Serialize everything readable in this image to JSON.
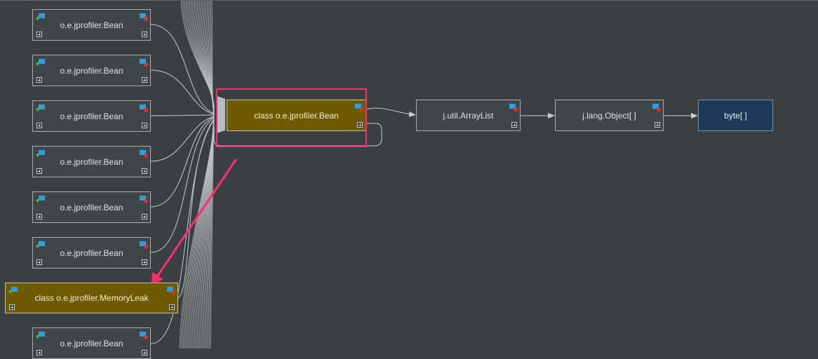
{
  "colors": {
    "background": "#3a3f41",
    "node": "#3f4548",
    "highlight_node": "#6e5a00",
    "array_node": "#1e3a58",
    "annotation": "#ff2d6e",
    "edge": "#c8cccf"
  },
  "icons": {
    "incoming": "incoming-references-icon",
    "outgoing": "outgoing-references-icon",
    "expand": "expand-plus-icon"
  },
  "left_nodes": [
    {
      "label": "o.e.jprofiler.Bean"
    },
    {
      "label": "o.e.jprofiler.Bean"
    },
    {
      "label": "o.e.jprofiler.Bean"
    },
    {
      "label": "o.e.jprofiler.Bean"
    },
    {
      "label": "o.e.jprofiler.Bean"
    },
    {
      "label": "o.e.jprofiler.Bean"
    },
    {
      "label": "class o.e.jprofiler.MemoryLeak"
    },
    {
      "label": "o.e.jprofiler.Bean"
    }
  ],
  "center_node": {
    "label": "class o.e.jprofiler.Bean"
  },
  "chain": [
    {
      "label": "j.util.ArrayList"
    },
    {
      "label": "j.lang.Object[ ]"
    },
    {
      "label": "byte[ ]"
    }
  ]
}
